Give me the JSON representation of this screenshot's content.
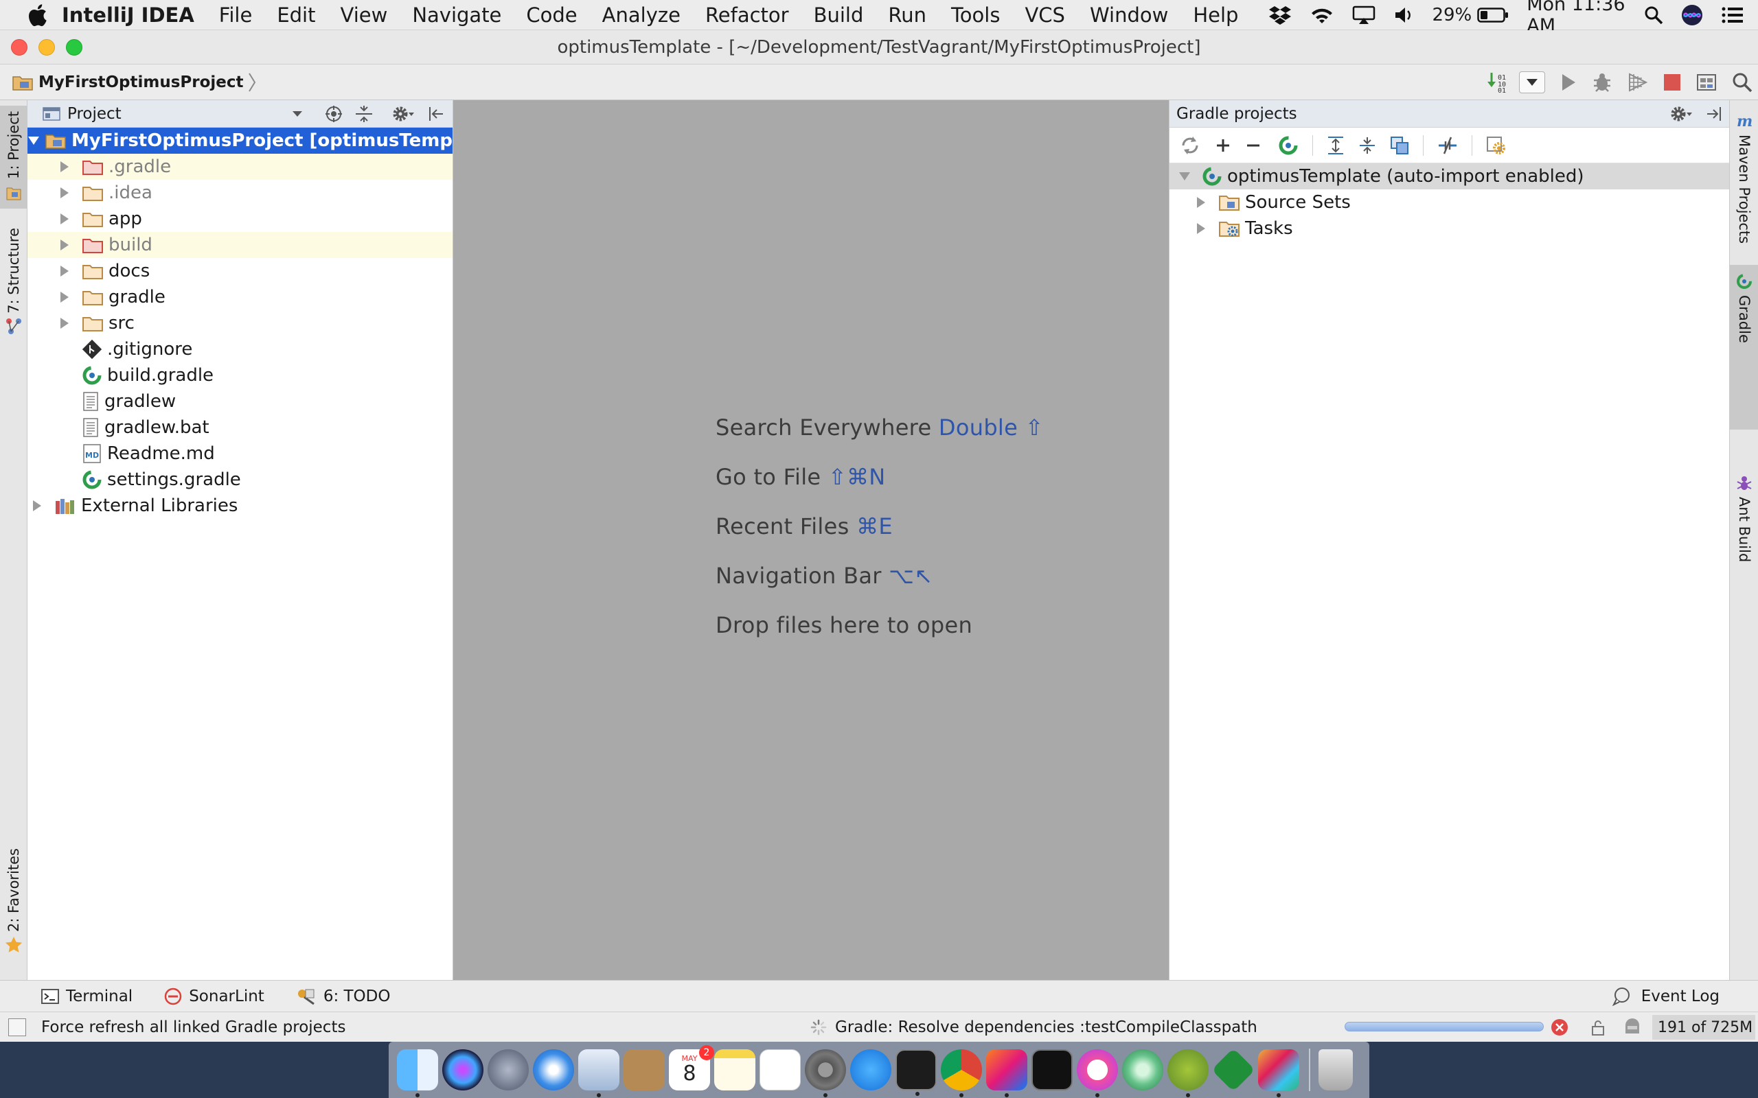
{
  "menubar": {
    "app_name": "IntelliJ IDEA",
    "items": [
      "File",
      "Edit",
      "View",
      "Navigate",
      "Code",
      "Analyze",
      "Refactor",
      "Build",
      "Run",
      "Tools",
      "VCS",
      "Window",
      "Help"
    ],
    "battery": "29%",
    "clock": "Mon 11:36 AM"
  },
  "window": {
    "title": "optimusTemplate - [~/Development/TestVagrant/MyFirstOptimusProject]"
  },
  "navbar": {
    "breadcrumb": "MyFirstOptimusProject"
  },
  "left_stripe": {
    "project": "1: Project",
    "structure": "7: Structure",
    "favorites": "2: Favorites"
  },
  "project_panel": {
    "title": "Project",
    "root": "MyFirstOptimusProject [optimusTemplate]",
    "items": [
      {
        "label": ".gradle",
        "icon": "folder-red-icon"
      },
      {
        "label": ".idea",
        "icon": "folder-icon"
      },
      {
        "label": "app",
        "icon": "folder-icon"
      },
      {
        "label": "build",
        "icon": "folder-red-icon"
      },
      {
        "label": "docs",
        "icon": "folder-icon"
      },
      {
        "label": "gradle",
        "icon": "folder-icon"
      },
      {
        "label": "src",
        "icon": "folder-icon"
      },
      {
        "label": ".gitignore",
        "icon": "git-file-icon"
      },
      {
        "label": "build.gradle",
        "icon": "gradle-file-icon"
      },
      {
        "label": "gradlew",
        "icon": "text-file-icon"
      },
      {
        "label": "gradlew.bat",
        "icon": "text-file-icon"
      },
      {
        "label": "Readme.md",
        "icon": "markdown-file-icon"
      },
      {
        "label": "settings.gradle",
        "icon": "gradle-file-icon"
      }
    ],
    "external": "External Libraries"
  },
  "editor": {
    "hints": [
      {
        "text": "Search Everywhere",
        "key": "Double ⇧"
      },
      {
        "text": "Go to File",
        "key": "⇧⌘N"
      },
      {
        "text": "Recent Files",
        "key": "⌘E"
      },
      {
        "text": "Navigation Bar",
        "key": "⌥↖"
      },
      {
        "text": "Drop files here to open",
        "key": ""
      }
    ]
  },
  "gradle_panel": {
    "title": "Gradle projects",
    "project": "optimusTemplate (auto-import enabled)",
    "children": [
      "Source Sets",
      "Tasks"
    ]
  },
  "right_stripe": {
    "maven": "Maven Projects",
    "gradle": "Gradle",
    "ant": "Ant Build"
  },
  "bottom_tools": {
    "terminal": "Terminal",
    "sonarlint": "SonarLint",
    "todo": "6: TODO",
    "event_log": "Event Log"
  },
  "statusbar": {
    "message": "Force refresh all linked Gradle projects",
    "task": "Gradle: Resolve dependencies :testCompileClasspath",
    "memory": "191 of 725M"
  },
  "dock": {
    "calendar_month": "MAY",
    "calendar_day": "8",
    "calendar_badge": "2"
  },
  "colors": {
    "selection": "#2160d7",
    "editor_bg": "#a9a9a9",
    "hint_key": "#2f55a8",
    "gradle_green": "#2e9e4c"
  }
}
